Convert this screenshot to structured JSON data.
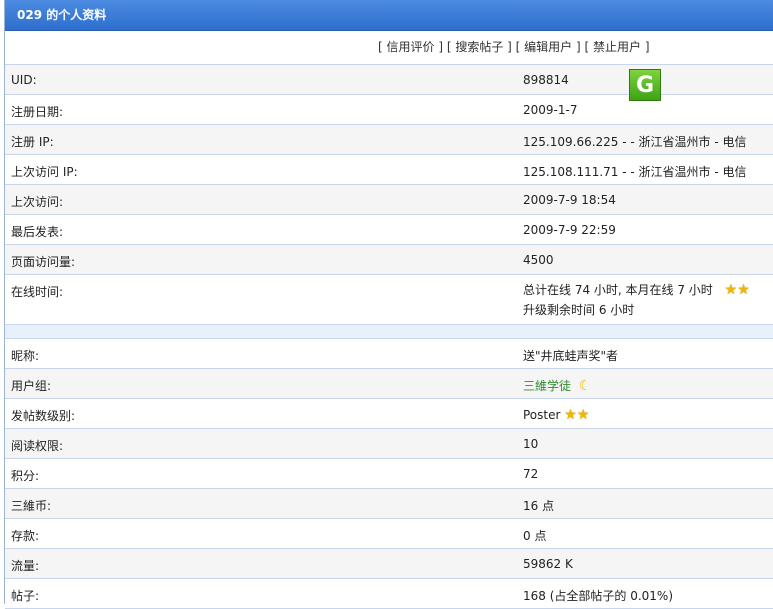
{
  "title": "029 的个人资料",
  "actions": [
    "信用评价",
    "搜索帖子",
    "编辑用户",
    "禁止用户"
  ],
  "rows1": [
    {
      "label": "UID:",
      "value": "898814"
    },
    {
      "label": "注册日期:",
      "value": "2009-1-7"
    },
    {
      "label": "注册 IP:",
      "value": "125.109.66.225 - - 浙江省温州市 - 电信"
    },
    {
      "label": "上次访问 IP:",
      "value": "125.108.111.71 - - 浙江省温州市 - 电信"
    },
    {
      "label": "上次访问:",
      "value": "2009-7-9 18:54"
    },
    {
      "label": "最后发表:",
      "value": "2009-7-9 22:59"
    },
    {
      "label": "页面访问量:",
      "value": "4500"
    }
  ],
  "online": {
    "label": "在线时间:",
    "line1": "总计在线 74 小时, 本月在线 7 小时",
    "line2": "升级剩余时间 6 小时"
  },
  "rows2": [
    {
      "label": "昵称:",
      "value": "送\"井底蛙声奖\"者"
    },
    {
      "label": "用户组:",
      "value": "三維学徒"
    },
    {
      "label": "发帖数级别:",
      "value": "Poster"
    },
    {
      "label": "阅读权限:",
      "value": "10"
    },
    {
      "label": "积分:",
      "value": "72"
    },
    {
      "label": "三維币:",
      "value": "16 点"
    },
    {
      "label": "存款:",
      "value": "0 点"
    },
    {
      "label": "流量:",
      "value": "59862 K"
    },
    {
      "label": "帖子:",
      "value": "168 (占全部帖子的 0.01%)"
    }
  ],
  "icons": {
    "star": "★",
    "moon": "☾",
    "g": "G"
  },
  "colors": {
    "accent": "#2e6fcf",
    "group": "#2e8b2e",
    "star": "#f1b700"
  }
}
